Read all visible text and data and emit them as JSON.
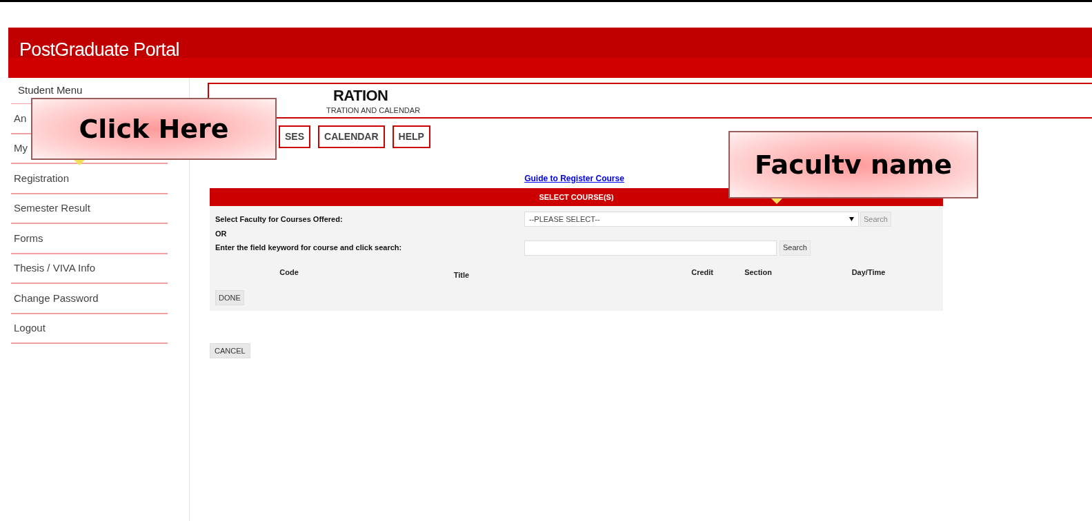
{
  "header": {
    "title": "PostGraduate Portal"
  },
  "sidebar": {
    "heading": "Student Menu",
    "items": [
      {
        "label": "An"
      },
      {
        "label": "My"
      },
      {
        "label": "Registration"
      },
      {
        "label": "Semester Result"
      },
      {
        "label": "Forms"
      },
      {
        "label": "Thesis / VIVA Info"
      },
      {
        "label": "Change Password"
      },
      {
        "label": "Logout"
      }
    ]
  },
  "page": {
    "title": "RATION",
    "subtitle": "TRATION AND CALENDAR"
  },
  "tabs": [
    {
      "label": "SES"
    },
    {
      "label": "CALENDAR"
    },
    {
      "label": "HELP"
    }
  ],
  "guide_link": "Guide to Register Course",
  "panel": {
    "title": "SELECT COURSE(S)",
    "faculty_label": "Select Faculty for Courses Offered:",
    "faculty_select": "--PLEASE SELECT--",
    "faculty_search": "Search",
    "or": "OR",
    "keyword_label": "Enter the field keyword for course and click search:",
    "keyword_search": "Search",
    "columns": [
      "Code",
      "Title",
      "Credit",
      "Section",
      "Day/Time"
    ],
    "done": "DONE"
  },
  "cancel": "CANCEL",
  "callouts": [
    {
      "kind": "sidebar",
      "text": "Click Here"
    },
    {
      "kind": "faculty",
      "text": "Facultv name"
    }
  ]
}
